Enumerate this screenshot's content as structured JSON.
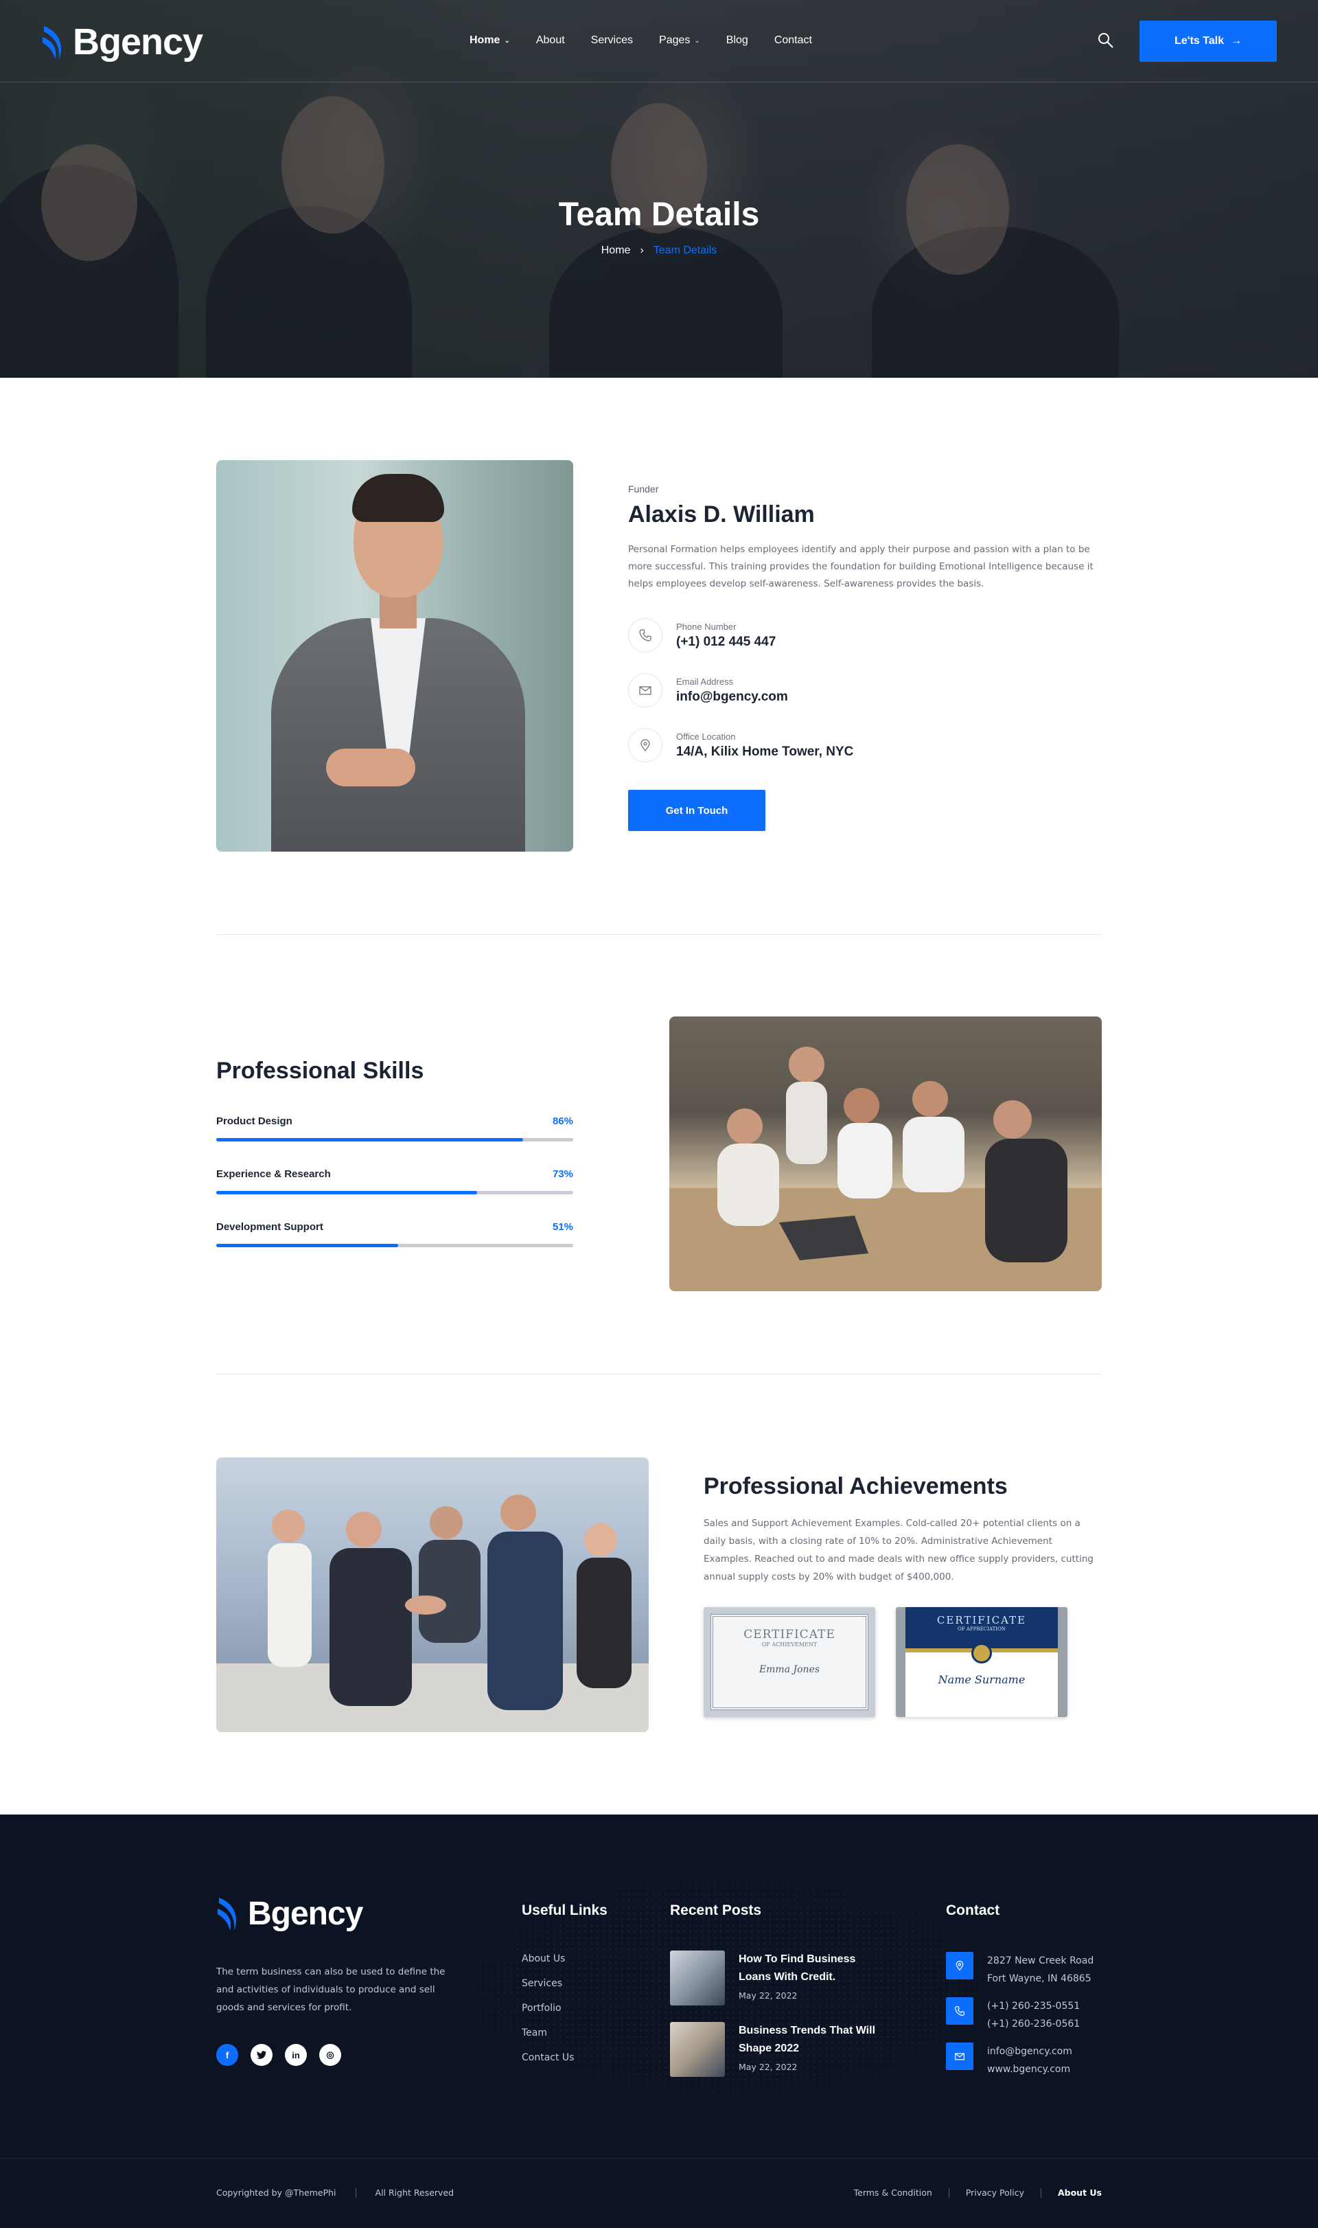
{
  "brand": {
    "name": "Bgency"
  },
  "nav": {
    "items": [
      {
        "label": "Home",
        "has_dropdown": true,
        "active": true
      },
      {
        "label": "About",
        "has_dropdown": false
      },
      {
        "label": "Services",
        "has_dropdown": false
      },
      {
        "label": "Pages",
        "has_dropdown": true
      },
      {
        "label": "Blog",
        "has_dropdown": false
      },
      {
        "label": "Contact",
        "has_dropdown": false
      }
    ],
    "search_icon": "search-icon",
    "cta_label": "Le'ts Talk",
    "cta_icon": "arrow-right-icon"
  },
  "hero": {
    "title": "Team Details",
    "breadcrumb": {
      "home": "Home",
      "separator": "›",
      "current": "Team Details"
    }
  },
  "profile": {
    "role": "Funder",
    "name": "Alaxis D. William",
    "bio": "Personal Formation helps employees identify and apply their purpose and passion with a plan to be more successful. This training provides the foundation for building Emotional Intelligence because it helps employees develop self-awareness. Self-awareness provides the basis.",
    "contacts": [
      {
        "icon": "phone-icon",
        "label": "Phone Number",
        "value": "(+1) 012 445 447"
      },
      {
        "icon": "mail-icon",
        "label": "Email Address",
        "value": "info@bgency.com"
      },
      {
        "icon": "location-pin-icon",
        "label": "Office Location",
        "value": "14/A, Kilix Home Tower, NYC"
      }
    ],
    "button_label": "Get In Touch"
  },
  "skills": {
    "title": "Professional Skills",
    "items": [
      {
        "label": "Product Design",
        "percent_label": "86%",
        "value": 0.86
      },
      {
        "label": "Experience & Research",
        "percent_label": "73%",
        "value": 0.73
      },
      {
        "label": "Development Support",
        "percent_label": "51%",
        "value": 0.51
      }
    ]
  },
  "achievements": {
    "title": "Professional Achievements",
    "text": "Sales and Support Achievement Examples. Cold-called 20+ potential clients on a daily basis, with a closing rate of 10% to 20%. Administrative Achievement Examples. Reached out to and made deals with new office supply providers, cutting annual supply costs by 20% with  budget of $400,000.",
    "certificates": [
      {
        "heading": "CERTIFICATE",
        "sub": "OF ACHIEVEMENT",
        "name": "Emma Jones"
      },
      {
        "heading": "CERTIFICATE",
        "sub": "OF APPRECIATION",
        "name": "Name Surname"
      }
    ]
  },
  "footer": {
    "brand": "Bgency",
    "about": "The term business can also be used to define the and activities of individuals to produce and sell goods and services for profit.",
    "socials": [
      {
        "icon": "facebook-icon",
        "glyph": "f",
        "active": true
      },
      {
        "icon": "twitter-icon",
        "glyph": "t"
      },
      {
        "icon": "linkedin-icon",
        "glyph": "in"
      },
      {
        "icon": "instagram-icon",
        "glyph": "◎"
      }
    ],
    "useful_links": {
      "title": "Useful Links",
      "items": [
        "About Us",
        "Services",
        "Portfolio",
        "Team",
        "Contact Us"
      ]
    },
    "recent_posts": {
      "title": "Recent Posts",
      "items": [
        {
          "title": "How To Find Business Loans With Credit.",
          "date": "May 22, 2022"
        },
        {
          "title": "Business Trends That Will Shape 2022",
          "date": "May 22, 2022"
        }
      ]
    },
    "contact": {
      "title": "Contact",
      "address": [
        "2827 New Creek Road",
        "Fort Wayne, IN 46865"
      ],
      "phones": [
        "(+1) 260-235-0551",
        "(+1) 260-236-0561"
      ],
      "emails": [
        "info@bgency.com",
        "www.bgency.com"
      ]
    },
    "copyright": "Copyrighted by @ThemePhi",
    "rights": "All Right Reserved",
    "legal_links": [
      "Terms & Condition",
      "Privacy Policy",
      "About Us"
    ],
    "accent": "#0d6efd",
    "background": "#0c1322"
  }
}
